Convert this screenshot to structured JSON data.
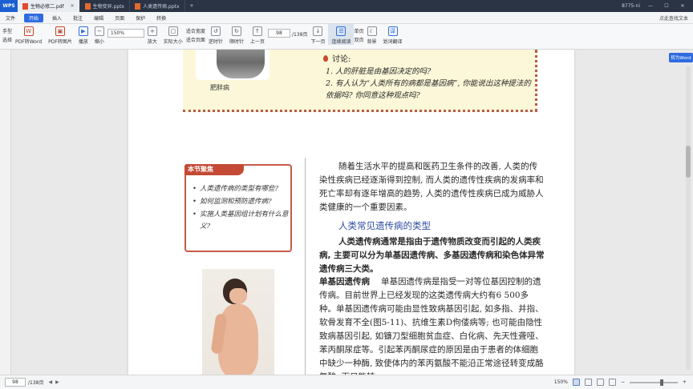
{
  "tabs": {
    "brand": "WPS",
    "items": [
      {
        "label": "生物必修二.pdf",
        "type": "pdf",
        "active": true
      },
      {
        "label": "生物变异.pptx",
        "type": "ppt",
        "active": false
      },
      {
        "label": "人类遗传病.pptx",
        "type": "ppt",
        "active": false
      }
    ],
    "plus": "+",
    "user": "8775-ni"
  },
  "menu": {
    "items": [
      "文件",
      "开始",
      "插入",
      "批注",
      "编辑",
      "页面",
      "保护",
      "转换"
    ],
    "search": "点此查找文本"
  },
  "toolbar": {
    "hand": "手型",
    "select": "选择",
    "pdf_to_word": "PDF转Word",
    "pdf_to_image": "PDF转图片",
    "play": "播放",
    "zoom_out": "缩小",
    "zoom_value": "150%",
    "zoom_in": "放大",
    "actual_size": "实际大小",
    "fit_width": "适合宽度",
    "fit_page": "适合页面",
    "rotate_left": "逆时针",
    "rotate_right": "顺时针",
    "prev_page": "上一页",
    "page_current": "98",
    "page_total": "/138页",
    "next_page": "下一页",
    "continuous": "连续阅读",
    "single": "单页",
    "double": "双页",
    "background": "背景",
    "translate": "划词翻译"
  },
  "document": {
    "figure_caption": "肥胖病",
    "discussion_title": "讨论:",
    "discussion_items": [
      "1. 人的肝脏是由基因决定的吗?",
      "2. 有人认为“人类所有的病都是基因病”, 你能说出这种提法的依据吗? 你同意这种观点吗?"
    ],
    "focus_title": "本节聚焦",
    "focus_items": [
      "人类遗传病的类型有哪些?",
      "如何监测和预防遗传病?",
      "实施人类基因组计划有什么意义?"
    ],
    "paragraph1": "随着生活水平的提高和医药卫生条件的改善, 人类的传染性疾病已经逐渐得到控制, 而人类的遗传性疾病的发病率和死亡率却有逐年增高的趋势, 人类的遗传性疾病已成为威胁人类健康的一个重要因素。",
    "section_title": "人类常见遗传病的类型",
    "paragraph2": "人类遗传病通常是指由于遗传物质改变而引起的人类疾病, 主要可以分为单基因遗传病、多基因遗传病和染色体异常遗传病三大类。",
    "p3_label": "单基因遗传病",
    "paragraph3": "单基因遗传病是指受一对等位基因控制的遗传病。目前世界上已经发现的这类遗传病大约有6 500多种。单基因遗传病可能由显性致病基因引起, 如多指、并指、软骨发育不全(图5-11)、抗维生素D佝偻病等; 也可能由隐性致病基因引起, 如镰刀型细胞贫血症、白化病、先天性聋哑、苯丙酮尿症等。引起苯丙酮尿症的原因是由于患者的体细胞中缺少一种酶, 致使体内的苯丙氨酸不能沿正常途径转变成酪氨酸, 而只能转"
  },
  "side": {
    "translate_btn": "转为Word"
  },
  "status": {
    "page": "98",
    "total": "/138页",
    "zoom": "150%"
  }
}
